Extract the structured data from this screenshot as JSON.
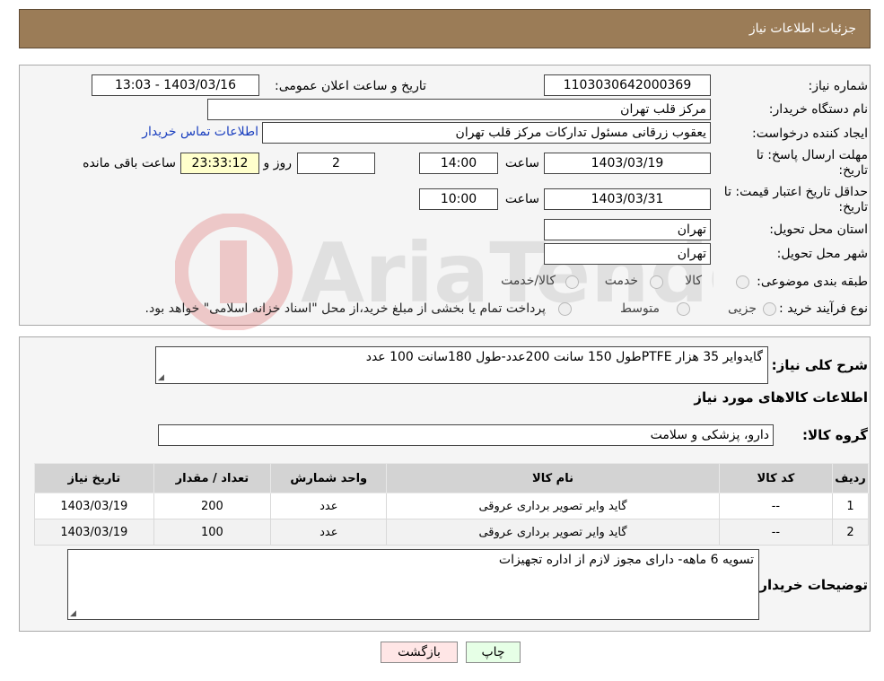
{
  "header": {
    "title": "جزئیات اطلاعات نیاز"
  },
  "form": {
    "need_number_label": "شماره نیاز:",
    "need_number": "1103030642000369",
    "announce_label": "تاریخ و ساعت اعلان عمومی:",
    "announce_value": "1403/03/16 - 13:03",
    "buyer_org_label": "نام دستگاه خریدار:",
    "buyer_org": "مرکز قلب تهران",
    "creator_label": "ایجاد کننده درخواست:",
    "creator": "یعقوب زرقانی مسئول تدارکات مرکز قلب تهران",
    "contact_link": "اطلاعات تماس خریدار",
    "deadline_label_1": "مهلت ارسال پاسخ: تا",
    "deadline_label_2": "تاریخ:",
    "deadline_date": "1403/03/19",
    "time_label": "ساعت",
    "deadline_time": "14:00",
    "days_value": "2",
    "days_label": "روز و",
    "remaining_time": "23:33:12",
    "remaining_label": "ساعت باقی مانده",
    "validity_label_1": "حداقل تاریخ اعتبار قیمت: تا",
    "validity_label_2": "تاریخ:",
    "validity_date": "1403/03/31",
    "validity_time_label": "ساعت",
    "validity_time": "10:00",
    "province_label": "استان محل تحویل:",
    "province": "تهران",
    "city_label": "شهر محل تحویل:",
    "city": "تهران",
    "category_label": "طبقه بندی موضوعی:",
    "category_options": [
      "کالا",
      "خدمت",
      "کالا/خدمت"
    ],
    "process_label": "نوع فرآیند خرید :",
    "process_options": [
      "جزیی",
      "متوسط"
    ],
    "process_note": "پرداخت تمام یا بخشی از مبلغ خرید،از محل \"اسناد خزانه اسلامی\" خواهد بود."
  },
  "details": {
    "description_label": "شرح کلی نیاز:",
    "description": "گایدوایر 35 هزار PTFEطول 150 سانت 200عدد-طول 180سانت 100 عدد",
    "goods_info_title": "اطلاعات کالاهای مورد نیاز",
    "goods_group_label": "گروه کالا:",
    "goods_group": "دارو، پزشکی و سلامت",
    "table": {
      "headers": [
        "ردیف",
        "کد کالا",
        "نام کالا",
        "واحد شمارش",
        "تعداد / مقدار",
        "تاریخ نیاز"
      ],
      "rows": [
        [
          "1",
          "--",
          "گاید وایر تصویر برداری عروقی",
          "عدد",
          "200",
          "1403/03/19"
        ],
        [
          "2",
          "--",
          "گاید وایر تصویر برداری عروقی",
          "عدد",
          "100",
          "1403/03/19"
        ]
      ]
    },
    "buyer_notes_label": "توضیحات خریدار:",
    "buyer_notes": "تسویه 6 ماهه- دارای مجوز لازم از اداره تجهیزات"
  },
  "buttons": {
    "print": "چاپ",
    "back": "بازگشت"
  },
  "colors": {
    "header_bg": "#9b7c57",
    "print_bg": "#e6ffe6",
    "back_bg": "#ffe6e6",
    "link": "#1a3fbf"
  }
}
